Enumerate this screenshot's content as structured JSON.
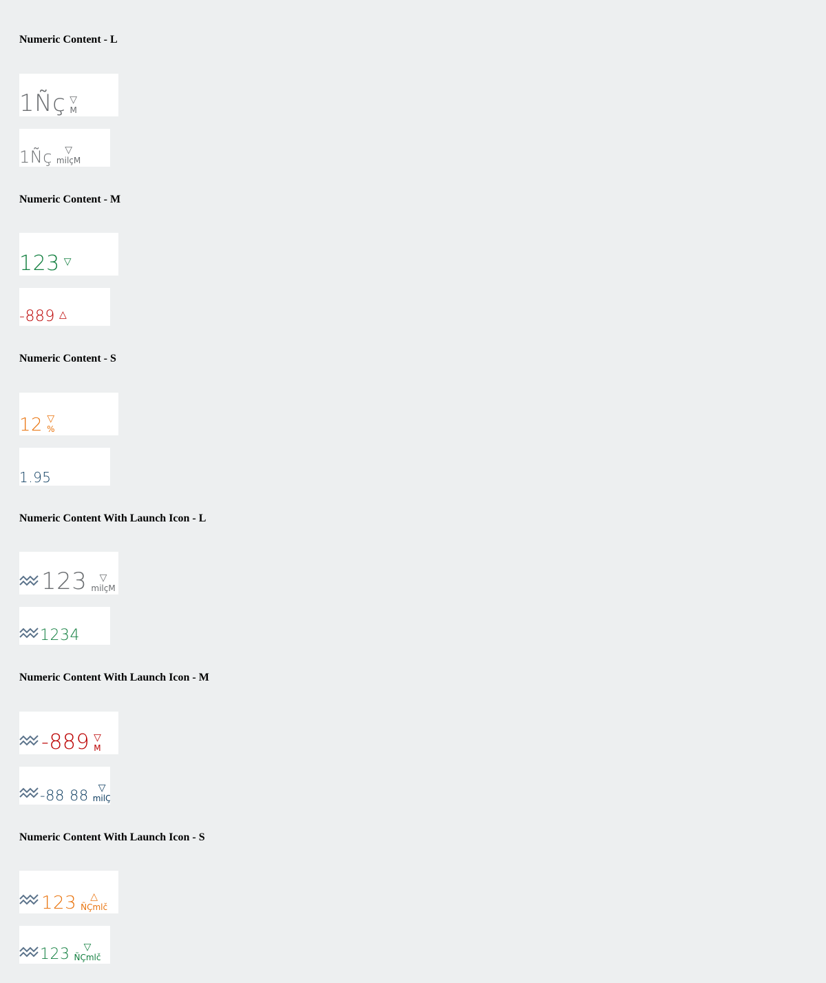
{
  "colors": {
    "neutral": "#6a6d70",
    "good": "#107e3e",
    "error": "#bb0000",
    "critical": "#e9730c",
    "dark": "#32363a",
    "blue": "#0a6ed1",
    "background": "#edeff0",
    "tile": "#ffffff",
    "icon": "#5b738b"
  },
  "sections": [
    {
      "title": "Numeric Content - L",
      "tiles": [
        {
          "value": "1Ñç",
          "indicator": "▽",
          "scale": "M",
          "icon": ""
        },
        {
          "value": "1Ñç",
          "indicator": "▽",
          "scale": "milçM",
          "icon": ""
        }
      ]
    },
    {
      "title": "Numeric Content - M",
      "tiles": [
        {
          "value": "123",
          "indicator": "▽",
          "scale": "",
          "icon": ""
        },
        {
          "value": "-889",
          "indicator": "△",
          "scale": "",
          "icon": ""
        }
      ]
    },
    {
      "title": "Numeric Content - S",
      "tiles": [
        {
          "value": "12",
          "indicator": "▽",
          "scale": "%",
          "icon": ""
        },
        {
          "value": "1.95",
          "indicator": "",
          "scale": "",
          "icon": ""
        }
      ]
    },
    {
      "title": "Numeric Content With Launch Icon - L",
      "tiles": [
        {
          "value": "123",
          "indicator": "▽",
          "scale": "milçM",
          "icon": "line-chart-icon"
        },
        {
          "value": "1234",
          "indicator": "",
          "scale": "",
          "icon": "line-chart-icon"
        }
      ]
    },
    {
      "title": "Numeric Content With Launch Icon - M",
      "tiles": [
        {
          "value": "-889",
          "indicator": "▽",
          "scale": "M",
          "icon": "line-chart-icon"
        },
        {
          "value": "-88 88",
          "indicator": "▽",
          "scale": "milÇ",
          "icon": "line-chart-icon"
        }
      ]
    },
    {
      "title": "Numeric Content With Launch Icon - S",
      "tiles": [
        {
          "value": "123",
          "indicator": "△",
          "scale": "ÑÇmlč",
          "icon": "line-chart-icon"
        },
        {
          "value": "123",
          "indicator": "▽",
          "scale": "ÑÇmlč",
          "icon": "line-chart-icon"
        }
      ]
    }
  ]
}
